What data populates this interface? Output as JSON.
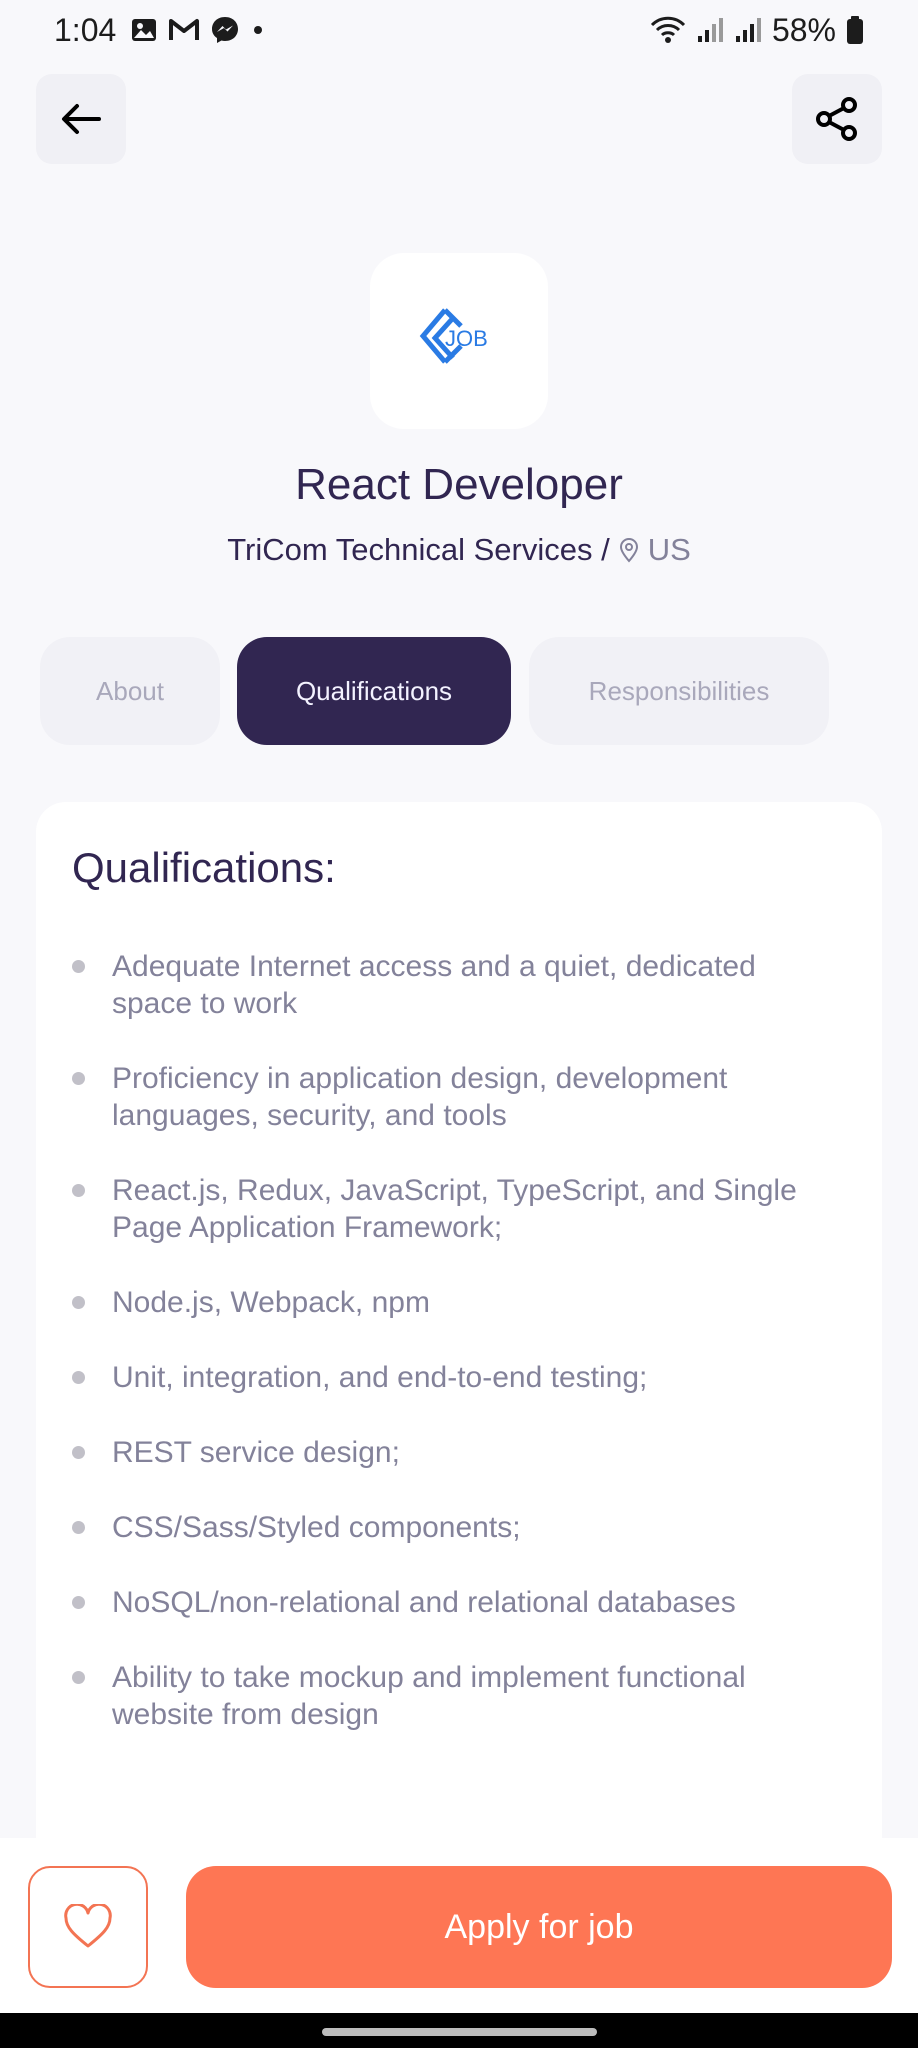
{
  "status_bar": {
    "time": "1:04",
    "battery": "58%",
    "icons": [
      "gallery-icon",
      "gmail-icon",
      "messenger-icon",
      "dot-icon",
      "wifi-icon",
      "signal-icon",
      "signal-icon",
      "battery-icon"
    ]
  },
  "header": {
    "back_icon": "arrow-left-icon",
    "share_icon": "share-icon"
  },
  "job": {
    "logo_text": "JOB",
    "title": "React Developer",
    "company": "TriCom Technical Services /",
    "location": "US"
  },
  "tabs": [
    {
      "label": "About",
      "active": false
    },
    {
      "label": "Qualifications",
      "active": true
    },
    {
      "label": "Responsibilities",
      "active": false
    }
  ],
  "qualifications": {
    "title": "Qualifications:",
    "items": [
      "Adequate Internet access and a quiet, dedicated space to work",
      "Proficiency in application design, development languages, security, and tools",
      "React.js, Redux, JavaScript, TypeScript, and Single Page Application Framework;",
      "Node.js, Webpack, npm",
      "Unit, integration, and end-to-end testing;",
      "REST service design;",
      "CSS/Sass/Styled components;",
      "NoSQL/non-relational and relational databases",
      "Ability to take mockup and implement functional website from design"
    ]
  },
  "footer": {
    "like_icon": "heart-icon",
    "apply_label": "Apply for job"
  },
  "colors": {
    "primary": "#312651",
    "accent": "#fe7654",
    "gray": "#83829a",
    "background": "#f8f8fb"
  }
}
